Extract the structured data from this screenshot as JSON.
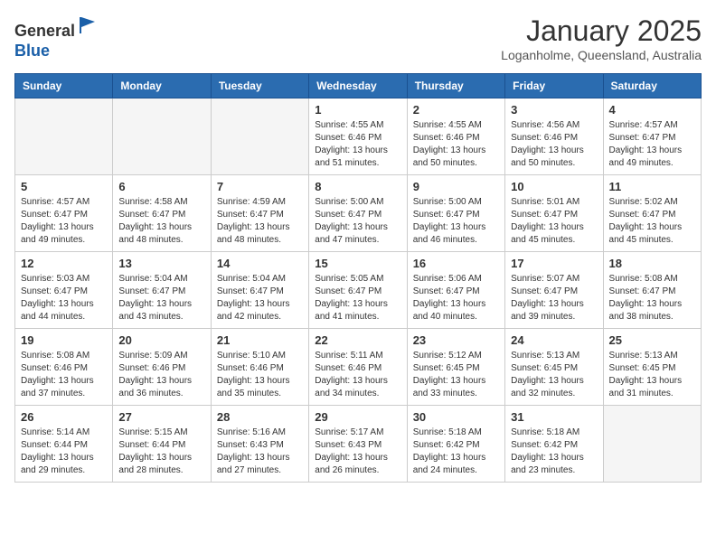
{
  "header": {
    "logo_general": "General",
    "logo_blue": "Blue",
    "month": "January 2025",
    "location": "Loganholme, Queensland, Australia"
  },
  "weekdays": [
    "Sunday",
    "Monday",
    "Tuesday",
    "Wednesday",
    "Thursday",
    "Friday",
    "Saturday"
  ],
  "weeks": [
    [
      {
        "day": "",
        "info": ""
      },
      {
        "day": "",
        "info": ""
      },
      {
        "day": "",
        "info": ""
      },
      {
        "day": "1",
        "info": "Sunrise: 4:55 AM\nSunset: 6:46 PM\nDaylight: 13 hours\nand 51 minutes."
      },
      {
        "day": "2",
        "info": "Sunrise: 4:55 AM\nSunset: 6:46 PM\nDaylight: 13 hours\nand 50 minutes."
      },
      {
        "day": "3",
        "info": "Sunrise: 4:56 AM\nSunset: 6:46 PM\nDaylight: 13 hours\nand 50 minutes."
      },
      {
        "day": "4",
        "info": "Sunrise: 4:57 AM\nSunset: 6:47 PM\nDaylight: 13 hours\nand 49 minutes."
      }
    ],
    [
      {
        "day": "5",
        "info": "Sunrise: 4:57 AM\nSunset: 6:47 PM\nDaylight: 13 hours\nand 49 minutes."
      },
      {
        "day": "6",
        "info": "Sunrise: 4:58 AM\nSunset: 6:47 PM\nDaylight: 13 hours\nand 48 minutes."
      },
      {
        "day": "7",
        "info": "Sunrise: 4:59 AM\nSunset: 6:47 PM\nDaylight: 13 hours\nand 48 minutes."
      },
      {
        "day": "8",
        "info": "Sunrise: 5:00 AM\nSunset: 6:47 PM\nDaylight: 13 hours\nand 47 minutes."
      },
      {
        "day": "9",
        "info": "Sunrise: 5:00 AM\nSunset: 6:47 PM\nDaylight: 13 hours\nand 46 minutes."
      },
      {
        "day": "10",
        "info": "Sunrise: 5:01 AM\nSunset: 6:47 PM\nDaylight: 13 hours\nand 45 minutes."
      },
      {
        "day": "11",
        "info": "Sunrise: 5:02 AM\nSunset: 6:47 PM\nDaylight: 13 hours\nand 45 minutes."
      }
    ],
    [
      {
        "day": "12",
        "info": "Sunrise: 5:03 AM\nSunset: 6:47 PM\nDaylight: 13 hours\nand 44 minutes."
      },
      {
        "day": "13",
        "info": "Sunrise: 5:04 AM\nSunset: 6:47 PM\nDaylight: 13 hours\nand 43 minutes."
      },
      {
        "day": "14",
        "info": "Sunrise: 5:04 AM\nSunset: 6:47 PM\nDaylight: 13 hours\nand 42 minutes."
      },
      {
        "day": "15",
        "info": "Sunrise: 5:05 AM\nSunset: 6:47 PM\nDaylight: 13 hours\nand 41 minutes."
      },
      {
        "day": "16",
        "info": "Sunrise: 5:06 AM\nSunset: 6:47 PM\nDaylight: 13 hours\nand 40 minutes."
      },
      {
        "day": "17",
        "info": "Sunrise: 5:07 AM\nSunset: 6:47 PM\nDaylight: 13 hours\nand 39 minutes."
      },
      {
        "day": "18",
        "info": "Sunrise: 5:08 AM\nSunset: 6:47 PM\nDaylight: 13 hours\nand 38 minutes."
      }
    ],
    [
      {
        "day": "19",
        "info": "Sunrise: 5:08 AM\nSunset: 6:46 PM\nDaylight: 13 hours\nand 37 minutes."
      },
      {
        "day": "20",
        "info": "Sunrise: 5:09 AM\nSunset: 6:46 PM\nDaylight: 13 hours\nand 36 minutes."
      },
      {
        "day": "21",
        "info": "Sunrise: 5:10 AM\nSunset: 6:46 PM\nDaylight: 13 hours\nand 35 minutes."
      },
      {
        "day": "22",
        "info": "Sunrise: 5:11 AM\nSunset: 6:46 PM\nDaylight: 13 hours\nand 34 minutes."
      },
      {
        "day": "23",
        "info": "Sunrise: 5:12 AM\nSunset: 6:45 PM\nDaylight: 13 hours\nand 33 minutes."
      },
      {
        "day": "24",
        "info": "Sunrise: 5:13 AM\nSunset: 6:45 PM\nDaylight: 13 hours\nand 32 minutes."
      },
      {
        "day": "25",
        "info": "Sunrise: 5:13 AM\nSunset: 6:45 PM\nDaylight: 13 hours\nand 31 minutes."
      }
    ],
    [
      {
        "day": "26",
        "info": "Sunrise: 5:14 AM\nSunset: 6:44 PM\nDaylight: 13 hours\nand 29 minutes."
      },
      {
        "day": "27",
        "info": "Sunrise: 5:15 AM\nSunset: 6:44 PM\nDaylight: 13 hours\nand 28 minutes."
      },
      {
        "day": "28",
        "info": "Sunrise: 5:16 AM\nSunset: 6:43 PM\nDaylight: 13 hours\nand 27 minutes."
      },
      {
        "day": "29",
        "info": "Sunrise: 5:17 AM\nSunset: 6:43 PM\nDaylight: 13 hours\nand 26 minutes."
      },
      {
        "day": "30",
        "info": "Sunrise: 5:18 AM\nSunset: 6:42 PM\nDaylight: 13 hours\nand 24 minutes."
      },
      {
        "day": "31",
        "info": "Sunrise: 5:18 AM\nSunset: 6:42 PM\nDaylight: 13 hours\nand 23 minutes."
      },
      {
        "day": "",
        "info": ""
      }
    ]
  ]
}
